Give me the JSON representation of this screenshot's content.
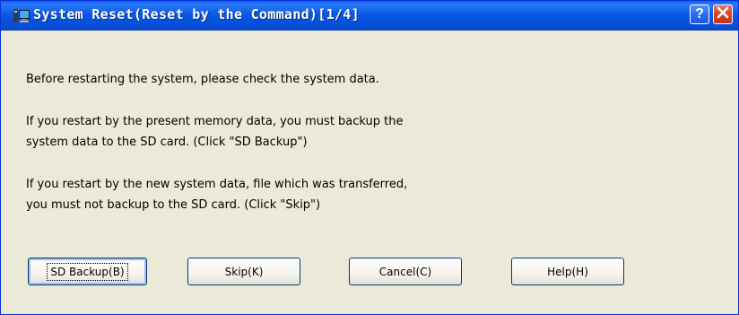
{
  "window": {
    "title": "System Reset(Reset by the Command)[1/4]",
    "help_glyph": "?",
    "close_icon": "close-icon",
    "app_icon": "monitor-icon"
  },
  "message": {
    "line1": "Before restarting the system, please check the system data.",
    "line2": "If you restart by the present memory data, you must backup the",
    "line3": "system data to the SD card. (Click \"SD Backup\")",
    "line4": "If you restart by the new system data, file which was transferred,",
    "line5": "you must not backup to the SD card. (Click \"Skip\")"
  },
  "buttons": {
    "sd_backup": "SD Backup(B)",
    "skip": "Skip(K)",
    "cancel": "Cancel(C)",
    "help": "Help(H)"
  },
  "colors": {
    "titlebar": "#0552dc",
    "close_button": "#d5432a",
    "dialog_background": "#ece9d8"
  }
}
